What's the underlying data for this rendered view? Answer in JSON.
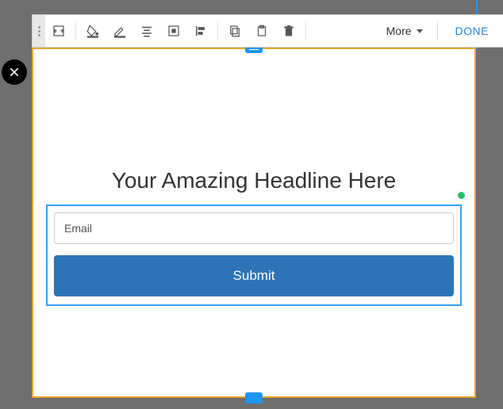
{
  "toolbar": {
    "more_label": "More",
    "done_label": "DONE"
  },
  "editor": {
    "headline": "Your Amazing Headline Here",
    "form": {
      "email_placeholder": "Email",
      "submit_label": "Submit"
    }
  }
}
